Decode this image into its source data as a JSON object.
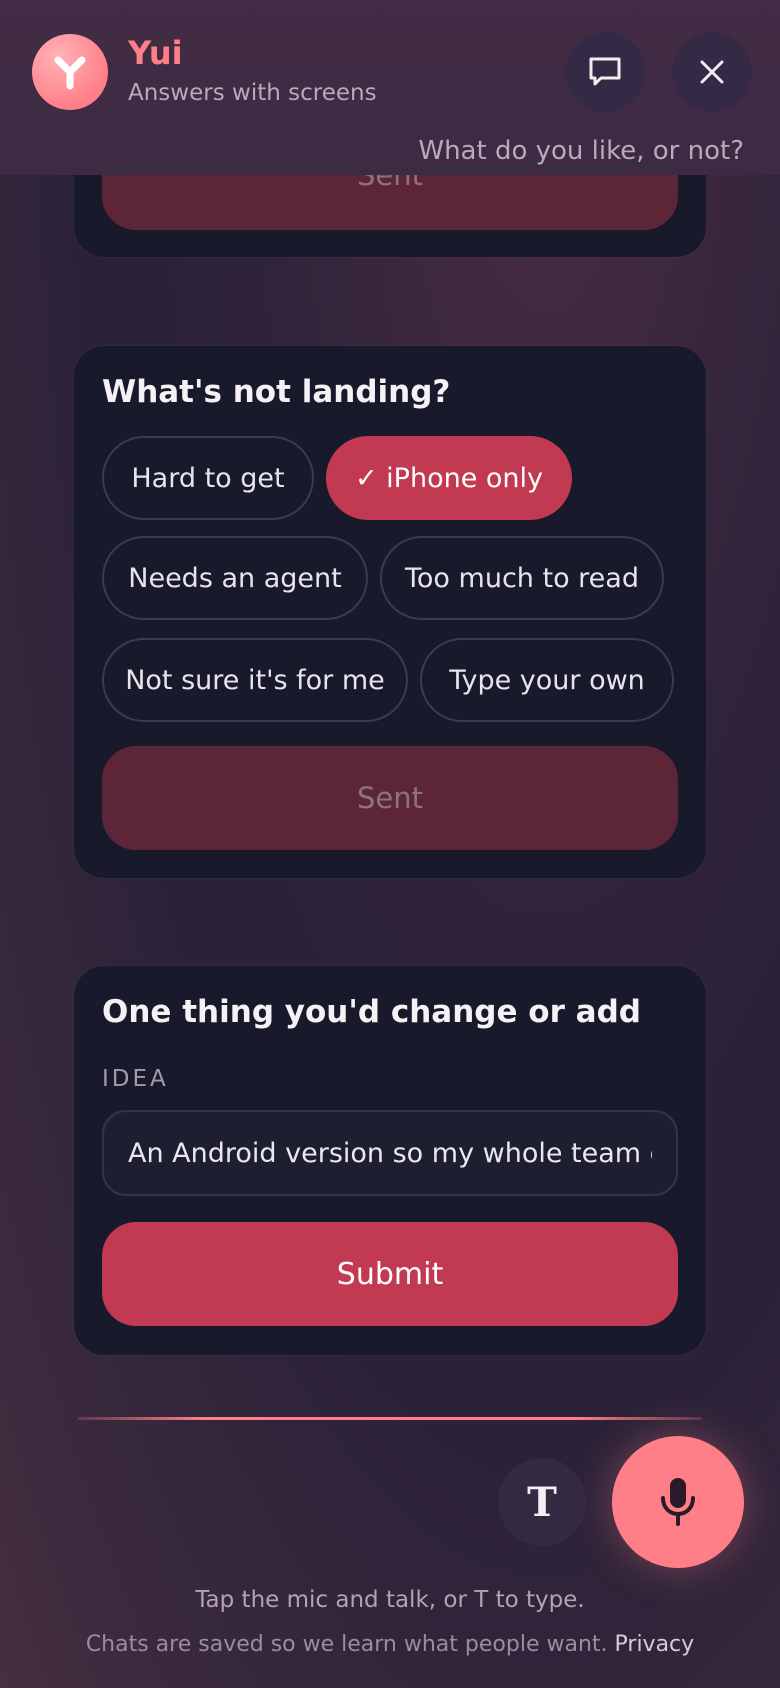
{
  "header": {
    "app_name": "Yui",
    "subtitle": "Answers with screens",
    "prompt": "What do you like, or not?",
    "chat_icon": "chat-bubble-icon",
    "close_icon": "close-icon"
  },
  "previous_card": {
    "button_label": "Sent"
  },
  "question_card": {
    "title": "What's not landing?",
    "chips": [
      {
        "label": "Hard to get",
        "selected": false
      },
      {
        "label": "✓ iPhone only",
        "selected": true
      },
      {
        "label": "Needs an agent",
        "selected": false
      },
      {
        "label": "Too much to read",
        "selected": false
      },
      {
        "label": "Not sure it's for me",
        "selected": false
      },
      {
        "label": "Type your own",
        "selected": false
      }
    ],
    "button_label": "Sent"
  },
  "idea_card": {
    "title": "One thing you'd change or add",
    "field_label": "IDEA",
    "field_value": "An Android version so my whole team can use it",
    "button_label": "Submit"
  },
  "composer": {
    "type_button_label": "T",
    "mic_icon": "microphone-icon",
    "hint": "Tap the mic and talk, or T to type.",
    "footnote": "Chats are saved so we learn what people want.",
    "privacy_link": "Privacy"
  },
  "colors": {
    "accent": "#ff7f88",
    "primary_button": "#c23a52",
    "disabled_button": "#5c2638",
    "card_bg": "#181a2c"
  }
}
